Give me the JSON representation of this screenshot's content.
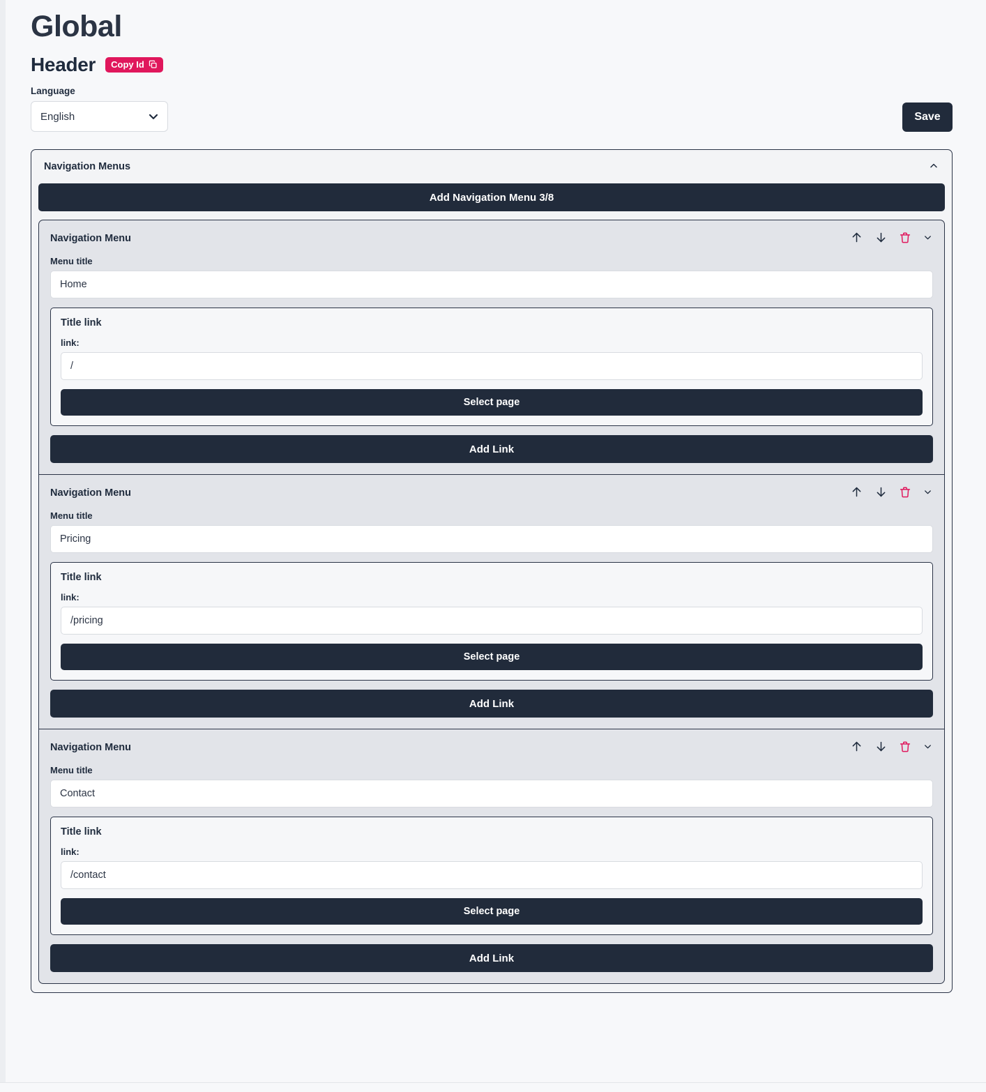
{
  "header": {
    "title": "Global",
    "subtitle": "Header",
    "copy_id_label": "Copy Id",
    "copy_id_icon": "copy-icon",
    "language_label": "Language",
    "language_value": "English",
    "language_chevron_icon": "chevron-down-icon",
    "save_label": "Save",
    "accent_color": "#e0175c",
    "dark_color": "#212b3b"
  },
  "section": {
    "title": "Navigation Menus",
    "collapse_icon": "chevron-up-icon",
    "add_menu_label": "Add Navigation Menu 3/8"
  },
  "labels": {
    "card_title": "Navigation Menu",
    "menu_title_label": "Menu title",
    "title_link_label": "Title link",
    "link_label": "link:",
    "select_page_label": "Select page",
    "add_link_label": "Add Link",
    "move_up_icon": "arrow-up-icon",
    "move_down_icon": "arrow-down-icon",
    "delete_icon": "trash-icon",
    "expand_icon": "chevron-down-icon"
  },
  "menus": [
    {
      "menu_title": "Home",
      "link": "/"
    },
    {
      "menu_title": "Pricing",
      "link": "/pricing"
    },
    {
      "menu_title": "Contact",
      "link": "/contact"
    }
  ]
}
